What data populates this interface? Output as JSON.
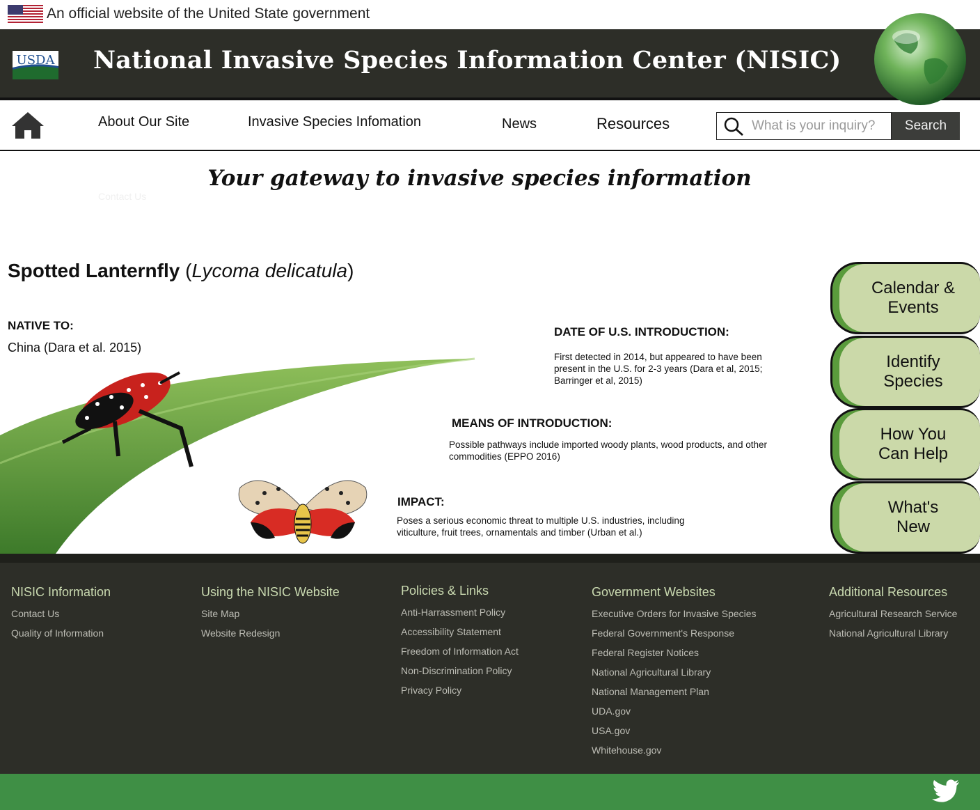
{
  "gov_banner": {
    "text": "An official website of the United State government",
    "flag_icon": "us-flag-icon"
  },
  "header": {
    "logo_text": "USDA",
    "title": "National Invasive Species Information Center (NISIC)",
    "globe_icon": "globe-icon"
  },
  "nav": {
    "home_icon": "home-icon",
    "links": [
      "About Our Site",
      "Invasive Species Infomation",
      "News",
      "Resources"
    ],
    "search_placeholder": "What is your inquiry?",
    "search_value": "",
    "search_button": "Search"
  },
  "tagline": "Your gateway to invasive species information",
  "hidden_link": "Contact Us",
  "species": {
    "common_name": "Spotted Lanternfly",
    "scientific_name": "Lycoma delicatula",
    "native_label": "NATIVE TO:",
    "native_value": "China (Dara et al. 2015)",
    "intro_date_label": "DATE OF U.S. INTRODUCTION:",
    "intro_date_text": "First detected in 2014, but appeared to have been present in the U.S. for 2-3 years (Dara et al, 2015; Barringer et al, 2015)",
    "means_label": "MEANS OF INTRODUCTION:",
    "means_text": "Possible pathways include imported woody plants, wood products, and other commodities (EPPO 2016)",
    "impact_label": "IMPACT:",
    "impact_text": "Poses a serious economic threat to multiple U.S. industries, including viticulture, fruit trees, ornamentals and timber (Urban et al.)"
  },
  "side_tabs": [
    "Calendar &\nEvents",
    "Identify\nSpecies",
    "How You\nCan Help",
    "What's\nNew"
  ],
  "footer": {
    "columns": [
      {
        "heading": "NISIC Information",
        "links": [
          "Contact Us",
          "Quality of Information"
        ]
      },
      {
        "heading": "Using the NISIC Website",
        "links": [
          "Site Map",
          "Website Redesign"
        ]
      },
      {
        "heading": "Policies & Links",
        "links": [
          "Anti-Harrassment Policy",
          "Accessibility Statement",
          "Freedom of Information Act",
          "Non-Discrimination Policy",
          "Privacy Policy"
        ]
      },
      {
        "heading": "Government Websites",
        "links": [
          "Executive Orders for Invasive Species",
          "Federal Government's Response",
          "Federal Register Notices",
          "National Agricultural Library",
          "National Management Plan",
          "UDA.gov",
          "USA.gov",
          "Whitehouse.gov"
        ]
      },
      {
        "heading": "Additional Resources",
        "links": [
          "Agricultural Research Service",
          "National Agricultural Library"
        ]
      }
    ]
  },
  "colors": {
    "header_bg": "#2d2e28",
    "tab_green": "#cbd9a9",
    "accent_green": "#5a9b3c",
    "bottom_bar": "#3f8f45"
  },
  "social": {
    "twitter_icon": "twitter-icon"
  }
}
